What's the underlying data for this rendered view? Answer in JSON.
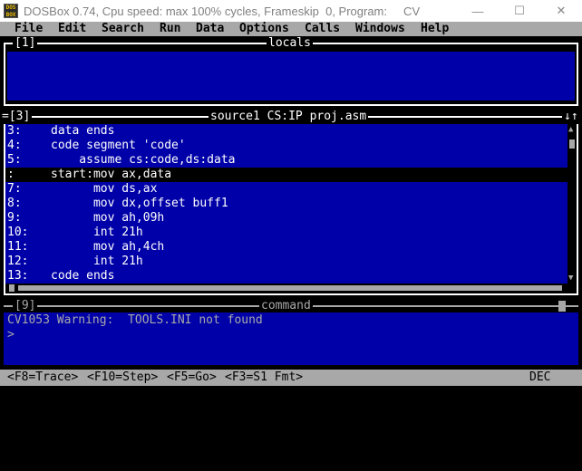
{
  "window": {
    "icon_text": "DOS BOX",
    "title": "DOSBox 0.74, Cpu speed: max 100% cycles, Frameskip  0, Program:     CV",
    "minimize": "—",
    "maximize": "☐",
    "close": "✕"
  },
  "menu": [
    {
      "label": "File"
    },
    {
      "label": "Edit"
    },
    {
      "label": "Search"
    },
    {
      "label": "Run"
    },
    {
      "label": "Data"
    },
    {
      "label": "Options"
    },
    {
      "label": "Calls"
    },
    {
      "label": "Windows"
    },
    {
      "label": "Help"
    }
  ],
  "locals_window": {
    "number": "[1]",
    "title": "locals"
  },
  "source_window": {
    "left_marker": "=[3]",
    "title": "source1 CS:IP proj.asm",
    "right_marker": "↓↑",
    "lines": [
      {
        "num": "3:",
        "code": "data ends"
      },
      {
        "num": "4:",
        "code": "code segment 'code'"
      },
      {
        "num": "5:",
        "code": "    assume cs:code,ds:data"
      },
      {
        "num": ":",
        "code": "start:mov ax,data"
      },
      {
        "num": "7:",
        "code": "      mov ds,ax"
      },
      {
        "num": "8:",
        "code": "      mov dx,offset buff1"
      },
      {
        "num": "9:",
        "code": "      mov ah,09h"
      },
      {
        "num": "10:",
        "code": "      int 21h"
      },
      {
        "num": "11:",
        "code": "      mov ah,4ch"
      },
      {
        "num": "12:",
        "code": "      int 21h"
      },
      {
        "num": "13:",
        "code": "code ends"
      }
    ],
    "current_line_index": 3,
    "scroll_up": "▲",
    "scroll_down": "▼"
  },
  "command_window": {
    "number": "[9]",
    "title": "command",
    "lines": [
      "CV1053 Warning:  TOOLS.INI not found",
      ">"
    ]
  },
  "status": {
    "items": [
      "<F8=Trace>",
      "<F10=Step>",
      "<F5=Go>",
      "<F3=S1 Fmt>"
    ],
    "mode": "DEC"
  }
}
